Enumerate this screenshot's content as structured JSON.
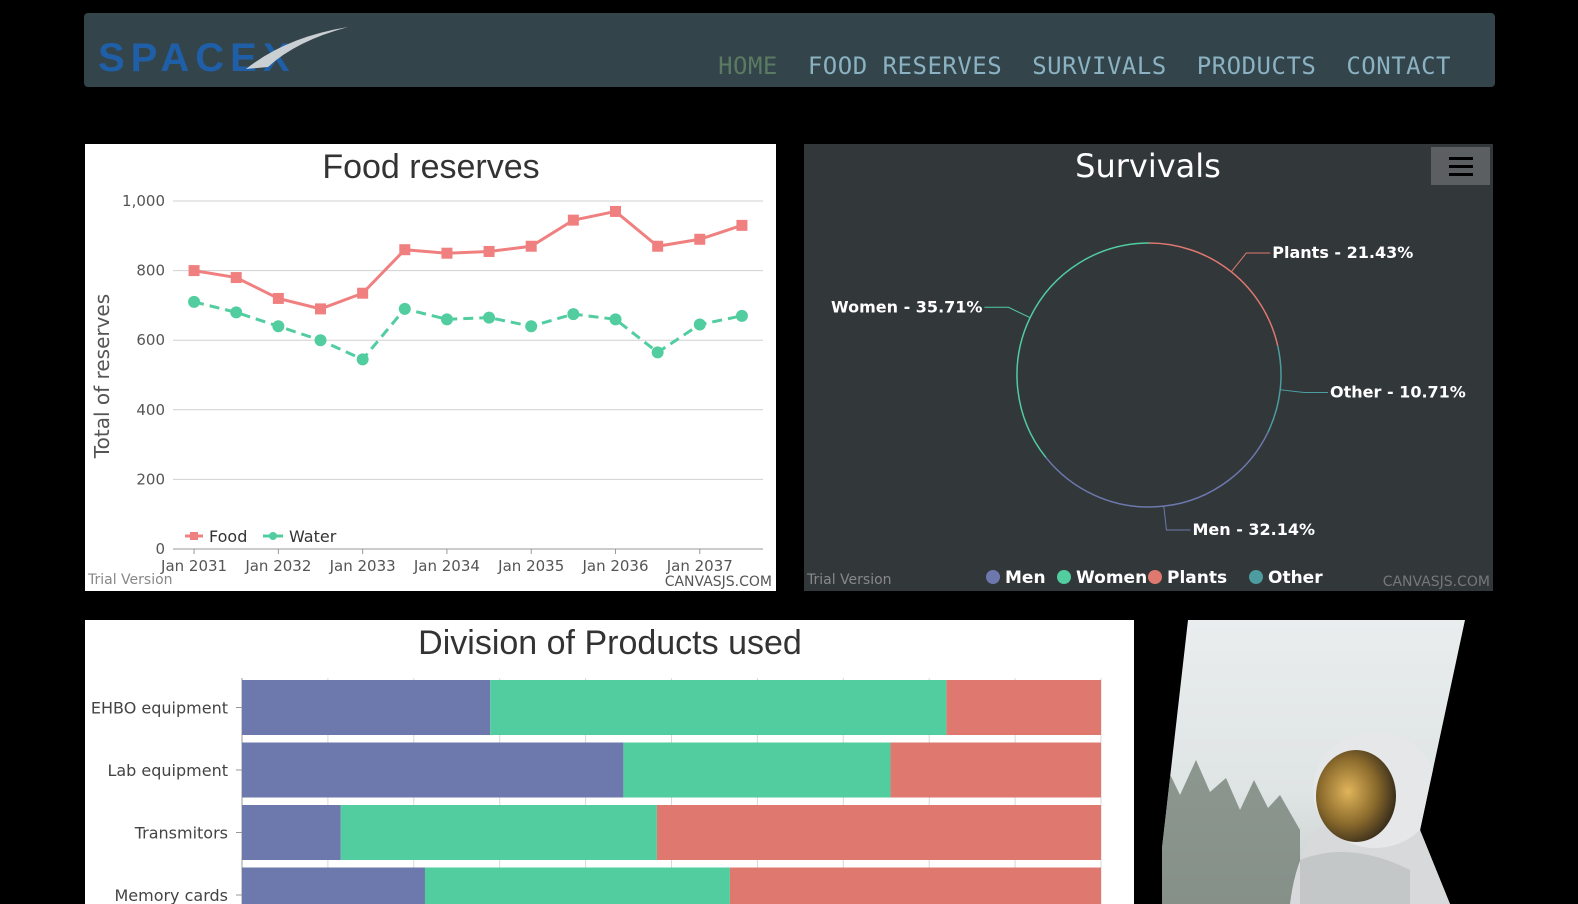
{
  "brand": {
    "logo_text": "SPACEX"
  },
  "nav": {
    "items": [
      "HOME",
      "FOOD RESERVES",
      "SURVIVALS",
      "PRODUCTS",
      "CONTACT"
    ],
    "active": "HOME"
  },
  "watermarks": {
    "trial": "Trial Version",
    "canvasjs": "CANVASJS.COM"
  },
  "colors": {
    "men": "#6d78ad",
    "women": "#51cda0",
    "plants": "#df7970",
    "other": "#4c9ca0"
  },
  "chart_data": [
    {
      "type": "line",
      "title": "Food reserves",
      "ylabel": "Total of reserves",
      "xlabel": "",
      "ylim": [
        0,
        1000
      ],
      "yticks": [
        "0",
        "200",
        "400",
        "600",
        "800",
        "1,000"
      ],
      "xticks": [
        "Jan 2031",
        "Jan 2032",
        "Jan 2033",
        "Jan 2034",
        "Jan 2035",
        "Jan 2036",
        "Jan 2037"
      ],
      "x": [
        "2031-01",
        "2031-07",
        "2032-01",
        "2032-07",
        "2033-01",
        "2033-07",
        "2034-01",
        "2034-07",
        "2035-01",
        "2035-07",
        "2036-01",
        "2036-07",
        "2037-01",
        "2037-07"
      ],
      "series": [
        {
          "name": "Food",
          "color": "#f08080",
          "marker": "square",
          "dash": false,
          "values": [
            800,
            780,
            720,
            690,
            735,
            860,
            850,
            855,
            870,
            945,
            970,
            870,
            890,
            930
          ]
        },
        {
          "name": "Water",
          "color": "#51cda0",
          "marker": "circle",
          "dash": true,
          "values": [
            710,
            680,
            640,
            600,
            545,
            690,
            660,
            665,
            640,
            675,
            660,
            565,
            645,
            670
          ]
        }
      ],
      "legend": "bottom-left",
      "grid": true
    },
    {
      "type": "pie",
      "style": "doughnut-outline",
      "title": "Survivals",
      "slices": [
        {
          "name": "Men",
          "value": 32.14,
          "label": "Men - 32.14%",
          "color": "#6d78ad"
        },
        {
          "name": "Women",
          "value": 35.71,
          "label": "Women - 35.71%",
          "color": "#51cda0"
        },
        {
          "name": "Plants",
          "value": 21.43,
          "label": "Plants - 21.43%",
          "color": "#df7970"
        },
        {
          "name": "Other",
          "value": 10.71,
          "label": "Other - 10.71%",
          "color": "#4c9ca0"
        }
      ],
      "legend": "bottom-center"
    },
    {
      "type": "bar",
      "stacking": "percent-horizontal",
      "title": "Division of Products used",
      "categories": [
        "EHBO equipment",
        "Lab equipment",
        "Transmitors",
        "Memory cards"
      ],
      "series": [
        {
          "color": "#6d78ad",
          "values": [
            28.9,
            44.4,
            11.5,
            21.3
          ]
        },
        {
          "color": "#51cda0",
          "values": [
            53.1,
            31.1,
            36.8,
            35.5
          ]
        },
        {
          "color": "#df7970",
          "values": [
            18.0,
            24.5,
            51.7,
            43.2
          ]
        }
      ]
    }
  ]
}
